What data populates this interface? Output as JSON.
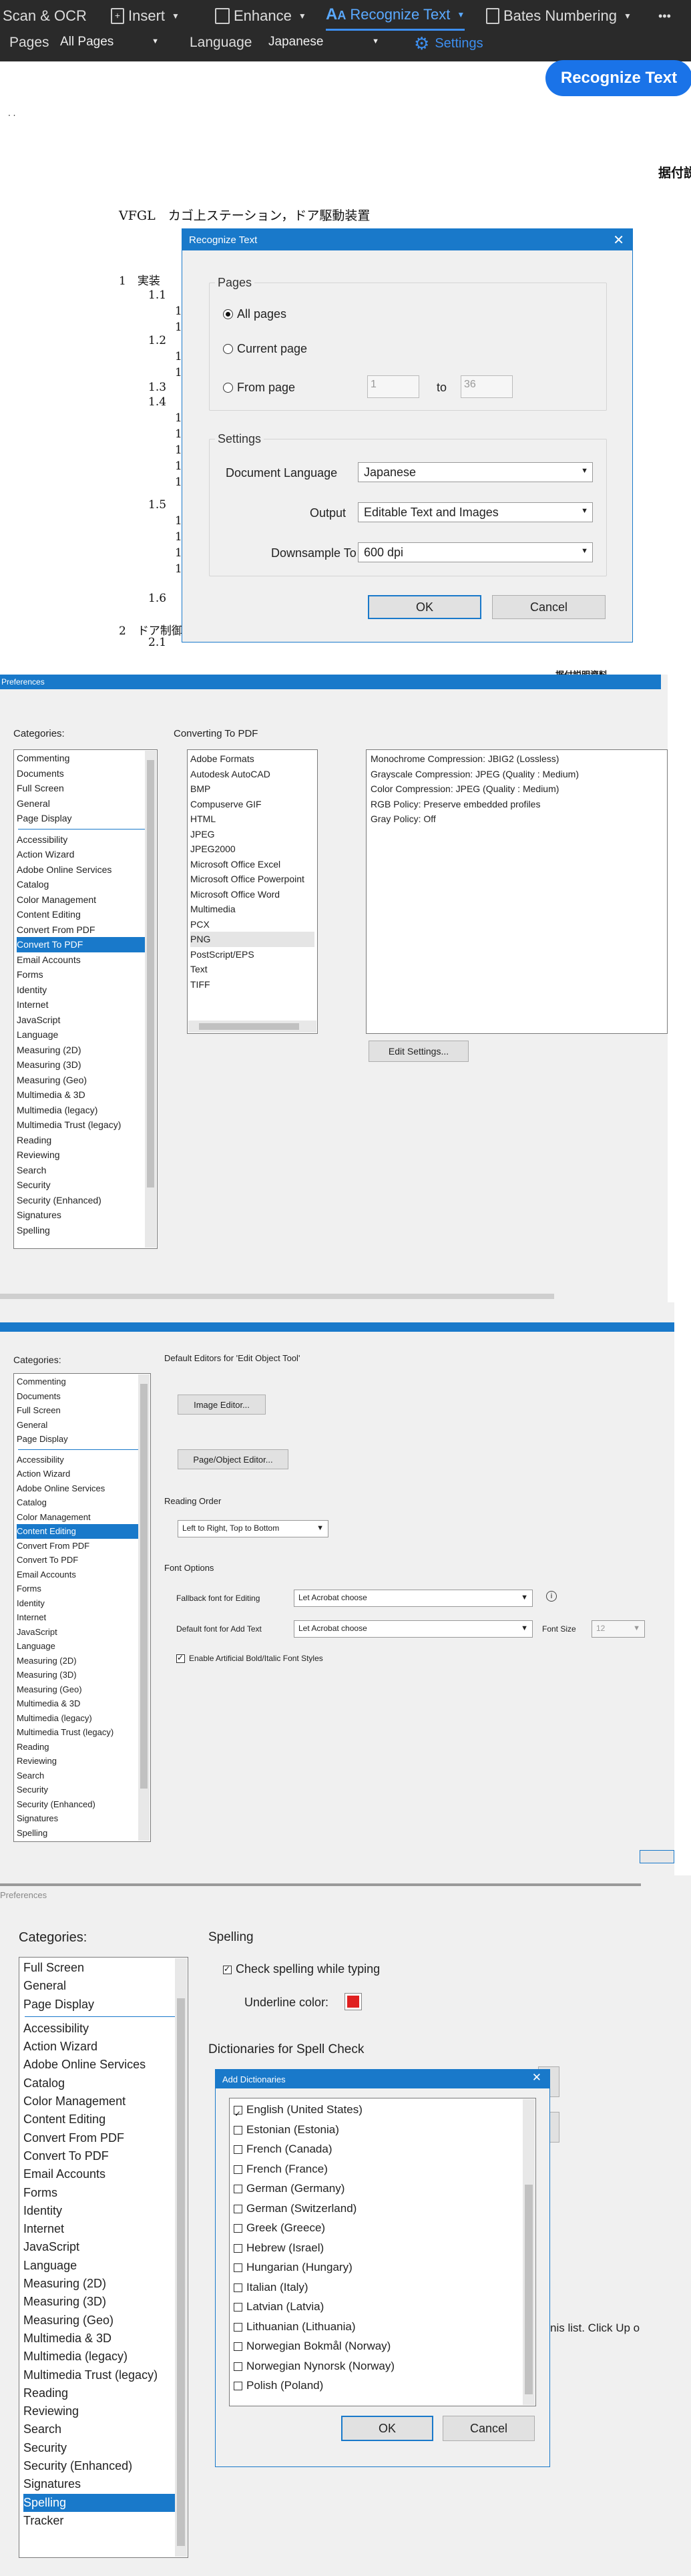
{
  "ocr": {
    "toolbar": {
      "scan_ocr": "Scan & OCR",
      "insert": "Insert",
      "enhance": "Enhance",
      "recognize_text": "Recognize Text",
      "bates": "Bates Numbering",
      "more": "•••"
    },
    "options": {
      "pages_label": "Pages",
      "pages_value": "All Pages",
      "language_label": "Language",
      "language_value": "Japanese",
      "settings_label": "Settings",
      "recognize_btn": "Recognize Text"
    },
    "doc": {
      "top_dots": "·    ·",
      "right_header": "据付説",
      "title": "VFGL　カゴ上ステーション，ドア駆動装置",
      "s1": "1　実装",
      "s11": "1.1",
      "s12": "1.2",
      "s13": "1.3",
      "s14": "1.4",
      "s15": "1.5",
      "s16": "1.6",
      "s2": "2　ドア制御",
      "s21": "2.1",
      "bottom_header": "据付説明資料"
    },
    "dialog": {
      "title": "Recognize Text",
      "pages_group": "Pages",
      "all_pages": "All pages",
      "current_page": "Current page",
      "from_page": "From page",
      "from_value": "1",
      "to": "to",
      "to_value": "36",
      "settings_group": "Settings",
      "doc_lang_label": "Document Language",
      "doc_lang_value": "Japanese",
      "output_label": "Output",
      "output_value": "Editable Text and Images",
      "downsample_label": "Downsample To",
      "downsample_value": "600 dpi",
      "ok": "OK",
      "cancel": "Cancel"
    }
  },
  "pref1": {
    "title": "Preferences",
    "categories_label": "Categories:",
    "categories_top": [
      "Commenting",
      "Documents",
      "Full Screen",
      "General",
      "Page Display"
    ],
    "categories": [
      "Accessibility",
      "Action Wizard",
      "Adobe Online Services",
      "Catalog",
      "Color Management",
      "Content Editing",
      "Convert From PDF",
      "Convert To PDF",
      "Email Accounts",
      "Forms",
      "Identity",
      "Internet",
      "JavaScript",
      "Language",
      "Measuring (2D)",
      "Measuring (3D)",
      "Measuring (Geo)",
      "Multimedia & 3D",
      "Multimedia (legacy)",
      "Multimedia Trust (legacy)",
      "Reading",
      "Reviewing",
      "Search",
      "Security",
      "Security (Enhanced)",
      "Signatures",
      "Spelling"
    ],
    "selected": "Convert To PDF",
    "section_title": "Converting To PDF",
    "formats": [
      "Adobe Formats",
      "Autodesk AutoCAD",
      "BMP",
      "Compuserve GIF",
      "HTML",
      "JPEG",
      "JPEG2000",
      "Microsoft Office Excel",
      "Microsoft Office Powerpoint",
      "Microsoft Office Word",
      "Multimedia",
      "PCX",
      "PNG",
      "PostScript/EPS",
      "Text",
      "TIFF"
    ],
    "selected_format": "PNG",
    "settings_lines": [
      "Monochrome Compression: JBIG2 (Lossless)",
      "Grayscale Compression: JPEG (Quality : Medium)",
      "Color Compression: JPEG (Quality : Medium)",
      "RGB Policy: Preserve embedded profiles",
      "Gray Policy: Off"
    ],
    "edit_settings": "Edit Settings..."
  },
  "pref2": {
    "categories_label": "Categories:",
    "categories_top": [
      "Commenting",
      "Documents",
      "Full Screen",
      "General",
      "Page Display"
    ],
    "categories": [
      "Accessibility",
      "Action Wizard",
      "Adobe Online Services",
      "Catalog",
      "Color Management",
      "Content Editing",
      "Convert From PDF",
      "Convert To PDF",
      "Email Accounts",
      "Forms",
      "Identity",
      "Internet",
      "JavaScript",
      "Language",
      "Measuring (2D)",
      "Measuring (3D)",
      "Measuring (Geo)",
      "Multimedia & 3D",
      "Multimedia (legacy)",
      "Multimedia Trust (legacy)",
      "Reading",
      "Reviewing",
      "Search",
      "Security",
      "Security (Enhanced)",
      "Signatures",
      "Spelling"
    ],
    "selected": "Content Editing",
    "editors_title": "Default Editors for 'Edit Object Tool'",
    "image_editor": "Image Editor...",
    "page_editor": "Page/Object Editor...",
    "reading_order_title": "Reading Order",
    "reading_order_value": "Left to Right, Top to Bottom",
    "font_options_title": "Font Options",
    "fallback_label": "Fallback font for Editing",
    "fallback_value": "Let Acrobat choose",
    "default_label": "Default font for Add Text",
    "default_value": "Let Acrobat choose",
    "font_size_label": "Font Size",
    "font_size_value": "12",
    "artificial_label": "Enable Artificial Bold/Italic Font Styles"
  },
  "pref3": {
    "title": "Preferences",
    "categories_label": "Categories:",
    "categories_top": [
      "Full Screen",
      "General",
      "Page Display"
    ],
    "categories": [
      "Accessibility",
      "Action Wizard",
      "Adobe Online Services",
      "Catalog",
      "Color Management",
      "Content Editing",
      "Convert From PDF",
      "Convert To PDF",
      "Email Accounts",
      "Forms",
      "Identity",
      "Internet",
      "JavaScript",
      "Language",
      "Measuring (2D)",
      "Measuring (3D)",
      "Measuring (Geo)",
      "Multimedia & 3D",
      "Multimedia (legacy)",
      "Multimedia Trust (legacy)",
      "Reading",
      "Reviewing",
      "Search",
      "Security",
      "Security (Enhanced)",
      "Signatures",
      "Spelling",
      "Tracker"
    ],
    "selected": "Spelling",
    "spelling_title": "Spelling",
    "check_spelling": "Check spelling while typing",
    "underline_color": "Underline color:",
    "underline_hex": "#e02020",
    "dicts_title": "Dictionaries for Spell Check",
    "hint_text": "nis list.  Click Up o",
    "add_dialog": {
      "title": "Add Dictionaries",
      "items": [
        {
          "label": "English (United States)",
          "checked": true
        },
        {
          "label": "Estonian (Estonia)",
          "checked": false
        },
        {
          "label": "French (Canada)",
          "checked": false
        },
        {
          "label": "French (France)",
          "checked": false
        },
        {
          "label": "German (Germany)",
          "checked": false
        },
        {
          "label": "German (Switzerland)",
          "checked": false
        },
        {
          "label": "Greek (Greece)",
          "checked": false
        },
        {
          "label": "Hebrew (Israel)",
          "checked": false
        },
        {
          "label": "Hungarian (Hungary)",
          "checked": false
        },
        {
          "label": "Italian (Italy)",
          "checked": false
        },
        {
          "label": "Latvian (Latvia)",
          "checked": false
        },
        {
          "label": "Lithuanian (Lithuania)",
          "checked": false
        },
        {
          "label": "Norwegian Bokmål (Norway)",
          "checked": false
        },
        {
          "label": "Norwegian Nynorsk (Norway)",
          "checked": false
        },
        {
          "label": "Polish (Poland)",
          "checked": false
        }
      ],
      "ok": "OK",
      "cancel": "Cancel"
    }
  }
}
